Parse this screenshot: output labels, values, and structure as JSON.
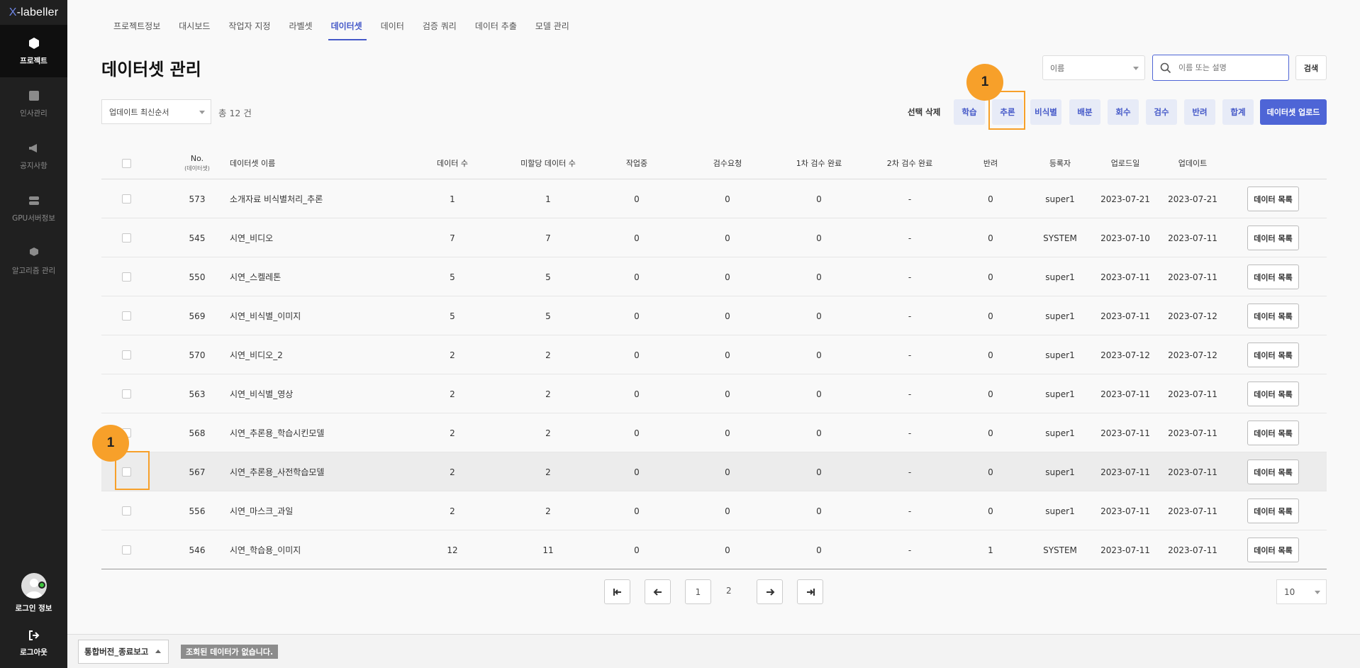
{
  "app": {
    "logo_x": "X",
    "logo_rest": "-labeller"
  },
  "sidebar": {
    "items": [
      {
        "label": "프로젝트",
        "icon": "cube-icon"
      },
      {
        "label": "인사관리",
        "icon": "id-card-icon"
      },
      {
        "label": "공지사항",
        "icon": "megaphone-icon"
      },
      {
        "label": "GPU서버정보",
        "icon": "server-icon"
      },
      {
        "label": "알고리즘 관리",
        "icon": "cubes-icon"
      }
    ],
    "login_label": "로그인 정보",
    "logout_label": "로그아웃"
  },
  "tabs": [
    "프로젝트정보",
    "대시보드",
    "작업자 지정",
    "라벨셋",
    "데이터셋",
    "데이터",
    "검증 쿼리",
    "데이터 추출",
    "모델 관리"
  ],
  "active_tab": "데이터셋",
  "page_title": "데이터셋 관리",
  "search": {
    "field_select": "이름",
    "placeholder": "이름 또는 설명",
    "button": "검색"
  },
  "controls": {
    "sort": "업데이트 최신순서",
    "total": "총 12 건",
    "select_delete": "선택 삭제",
    "actions": [
      "학습",
      "추론",
      "비식별",
      "배분",
      "회수",
      "검수",
      "반려",
      "합계"
    ],
    "upload": "데이터셋 업로드"
  },
  "table": {
    "headers": {
      "no": "No.",
      "no_sub": "(데이터셋)",
      "name": "데이터셋 이름",
      "data_count": "데이터 수",
      "unassigned": "미할당 데이터 수",
      "in_progress": "작업중",
      "review_req": "검수요청",
      "review1": "1차 검수 완료",
      "review2": "2차 검수 완료",
      "rejected": "반려",
      "registrant": "등록자",
      "upload_date": "업로드일",
      "update_date": "업데이트"
    },
    "list_button": "데이터 목록",
    "rows": [
      [
        "573",
        "소개자료 비식별처리_추론",
        "1",
        "1",
        "0",
        "0",
        "0",
        "-",
        "0",
        "super1",
        "2023-07-21",
        "2023-07-21"
      ],
      [
        "545",
        "시연_비디오",
        "7",
        "7",
        "0",
        "0",
        "0",
        "-",
        "0",
        "SYSTEM",
        "2023-07-10",
        "2023-07-11"
      ],
      [
        "550",
        "시연_스켈레톤",
        "5",
        "5",
        "0",
        "0",
        "0",
        "-",
        "0",
        "super1",
        "2023-07-11",
        "2023-07-11"
      ],
      [
        "569",
        "시연_비식별_이미지",
        "5",
        "5",
        "0",
        "0",
        "0",
        "-",
        "0",
        "super1",
        "2023-07-11",
        "2023-07-12"
      ],
      [
        "570",
        "시연_비디오_2",
        "2",
        "2",
        "0",
        "0",
        "0",
        "-",
        "0",
        "super1",
        "2023-07-12",
        "2023-07-12"
      ],
      [
        "563",
        "시연_비식별_영상",
        "2",
        "2",
        "0",
        "0",
        "0",
        "-",
        "0",
        "super1",
        "2023-07-11",
        "2023-07-11"
      ],
      [
        "568",
        "시연_추론용_학습시킨모델",
        "2",
        "2",
        "0",
        "0",
        "0",
        "-",
        "0",
        "super1",
        "2023-07-11",
        "2023-07-11"
      ],
      [
        "567",
        "시연_추론용_사전학습모델",
        "2",
        "2",
        "0",
        "0",
        "0",
        "-",
        "0",
        "super1",
        "2023-07-11",
        "2023-07-11"
      ],
      [
        "556",
        "시연_마스크_과일",
        "2",
        "2",
        "0",
        "0",
        "0",
        "-",
        "0",
        "super1",
        "2023-07-11",
        "2023-07-11"
      ],
      [
        "546",
        "시연_학습용_이미지",
        "12",
        "11",
        "0",
        "0",
        "0",
        "-",
        "1",
        "SYSTEM",
        "2023-07-11",
        "2023-07-11"
      ]
    ]
  },
  "pagination": {
    "pages": [
      "1",
      "2"
    ],
    "current": "1",
    "page_size": "10"
  },
  "bottombar": {
    "version": "통합버전_종료보고",
    "status": "조회된 데이터가 없습니다."
  },
  "annotations": [
    "1",
    "1"
  ],
  "colors": {
    "accent": "#4e65d6",
    "annotation": "#f7a02a",
    "sidebar": "#202020"
  }
}
